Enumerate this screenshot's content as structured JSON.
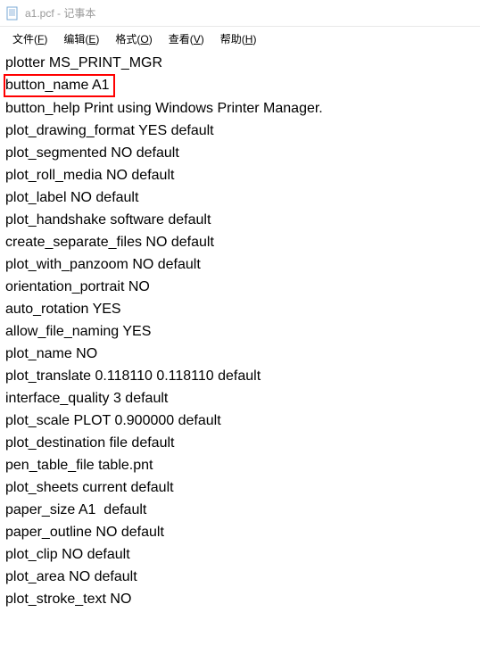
{
  "titlebar": {
    "title": "a1.pcf - 记事本"
  },
  "menubar": {
    "file": {
      "label": "文件",
      "key": "F"
    },
    "edit": {
      "label": "编辑",
      "key": "E"
    },
    "format": {
      "label": "格式",
      "key": "O"
    },
    "view": {
      "label": "查看",
      "key": "V"
    },
    "help": {
      "label": "帮助",
      "key": "H"
    }
  },
  "content": {
    "lines": [
      "plotter MS_PRINT_MGR",
      "button_name A1",
      "button_help Print using Windows Printer Manager.",
      "plot_drawing_format YES default",
      "plot_segmented NO default",
      "plot_roll_media NO default",
      "plot_label NO default",
      "plot_handshake software default",
      "create_separate_files NO default",
      "plot_with_panzoom NO default",
      "orientation_portrait NO",
      "auto_rotation YES",
      "allow_file_naming YES",
      "plot_name NO",
      "plot_translate 0.118110 0.118110 default",
      "interface_quality 3 default",
      "plot_scale PLOT 0.900000 default",
      "plot_destination file default",
      "pen_table_file table.pnt",
      "plot_sheets current default",
      "paper_size A1  default",
      "paper_outline NO default",
      "plot_clip NO default",
      "plot_area NO default",
      "plot_stroke_text NO"
    ],
    "highlighted_line_index": 1
  }
}
